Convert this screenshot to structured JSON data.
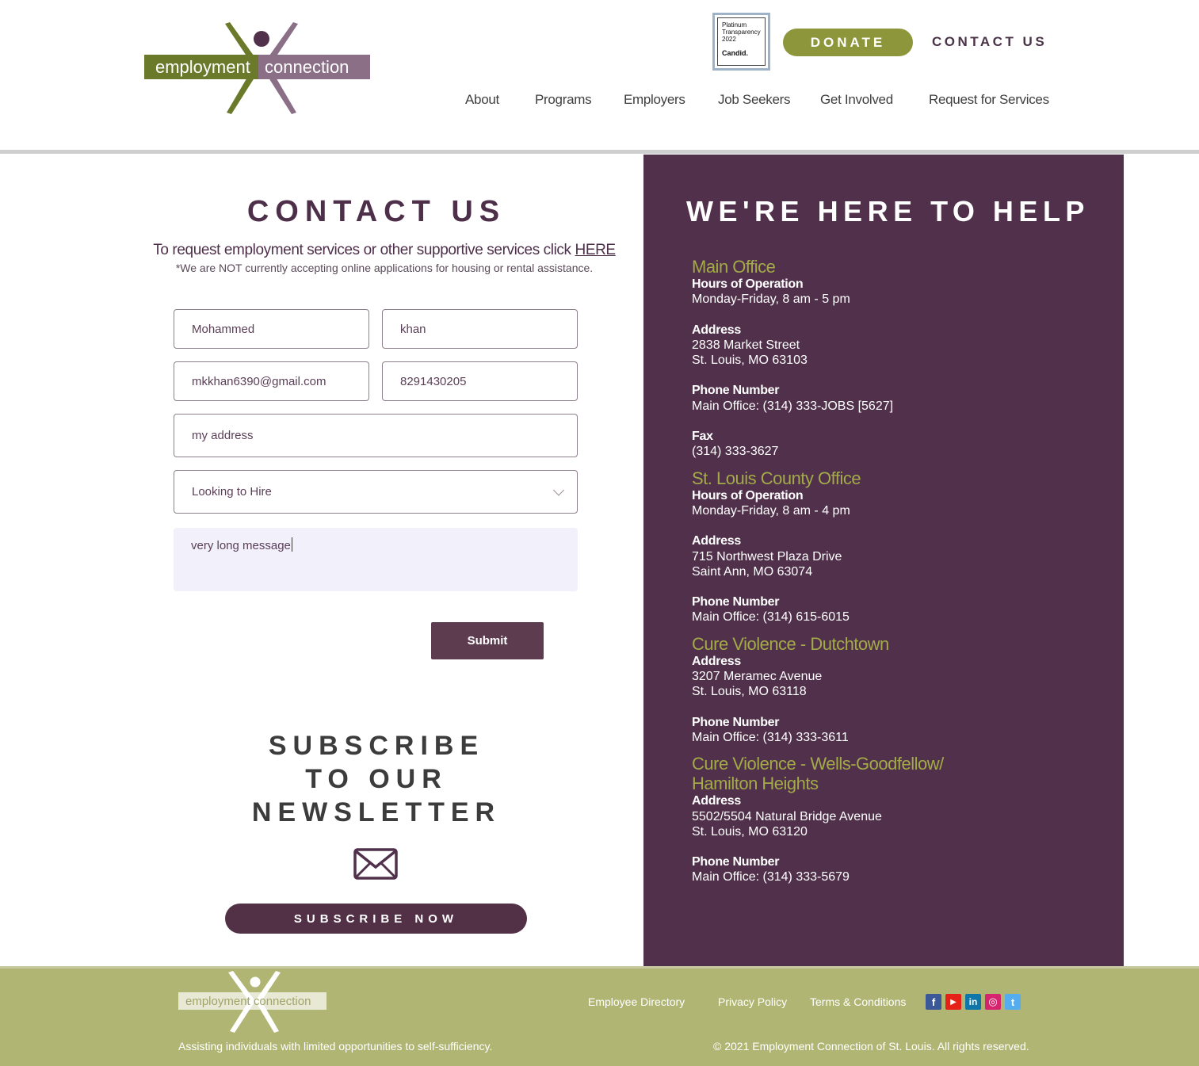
{
  "brand": {
    "logo_text": "employment connection",
    "colors": {
      "plum": "#50304a",
      "olive": "#8e963c",
      "olive_light": "#a3ab48",
      "footer": "#b1b574"
    }
  },
  "header": {
    "candid_badge": {
      "line1": "Platinum",
      "line2": "Transparency",
      "line3": "2022",
      "line4": "Candid."
    },
    "donate_label": "DONATE",
    "contact_label": "CONTACT US",
    "nav": [
      "About",
      "Programs",
      "Employers",
      "Job Seekers",
      "Get Involved",
      "Request for Services"
    ]
  },
  "contact": {
    "title": "CONTACT US",
    "request_text": "To request employment services or other supportive services click ",
    "request_link": "HERE",
    "note": "*We are NOT currently accepting online applications for housing or rental assistance.",
    "form": {
      "first_name": "Mohammed",
      "last_name": "khan",
      "email": "mkkhan6390@gmail.com",
      "phone": "8291430205",
      "address": "my address",
      "inquiry_type": "Looking to Hire",
      "message": "very long message",
      "submit_label": "Submit"
    }
  },
  "newsletter": {
    "title_line1": "SUBSCRIBE",
    "title_line2": "TO OUR",
    "title_line3": "NEWSLETTER",
    "button_label": "SUBSCRIBE NOW",
    "icon": "envelope-icon"
  },
  "help": {
    "title": "WE'RE HERE TO HELP",
    "offices": [
      {
        "name": "Main Office",
        "hours_label": "Hours of Operation",
        "hours": "Monday-Friday, 8 am - 5 pm",
        "address_label": "Address",
        "address_line1": "2838 Market Street",
        "address_line2": "St. Louis, MO 63103",
        "phone_label": "Phone Number",
        "phone": "Main Office: (314) 333-JOBS [5627]",
        "fax_label": "Fax",
        "fax": "(314) 333-3627"
      },
      {
        "name": "St. Louis County Office",
        "hours_label": "Hours of Operation",
        "hours": "Monday-Friday, 8 am - 4 pm",
        "address_label": "Address",
        "address_line1": "715 Northwest Plaza Drive",
        "address_line2": "Saint Ann, MO 63074",
        "phone_label": "Phone Number",
        "phone": "Main Office: (314) 615-6015"
      },
      {
        "name": "Cure Violence - Dutchtown",
        "address_label": "Address",
        "address_line1": "3207 Meramec Avenue",
        "address_line2": "St. Louis, MO 63118",
        "phone_label": "Phone Number",
        "phone": "Main Office: (314) 333-3611"
      },
      {
        "name_line1": "Cure Violence - Wells-Goodfellow/",
        "name_line2": "Hamilton Heights",
        "address_label": "Address",
        "address_line1": "5502/5504 Natural Bridge Avenue",
        "address_line2": "St. Louis, MO 63120",
        "phone_label": "Phone Number",
        "phone": "Main Office: (314) 333-5679"
      }
    ]
  },
  "footer": {
    "logo_text": "employment connection",
    "tagline": "Assisting individuals with limited opportunities to self-sufficiency.",
    "links": [
      "Employee Directory",
      "Privacy Policy",
      "Terms & Conditions"
    ],
    "copyright": "© 2021 Employment Connection of St. Louis. All rights reserved.",
    "social": [
      {
        "icon": "facebook-icon",
        "glyph": "f",
        "color": "#3b5998"
      },
      {
        "icon": "youtube-icon",
        "glyph": "▶",
        "color": "#e62117"
      },
      {
        "icon": "linkedin-icon",
        "glyph": "in",
        "color": "#0e76a8"
      },
      {
        "icon": "instagram-icon",
        "glyph": "◎",
        "color": "#d6246e"
      },
      {
        "icon": "twitter-icon",
        "glyph": "t",
        "color": "#55acee"
      }
    ]
  }
}
